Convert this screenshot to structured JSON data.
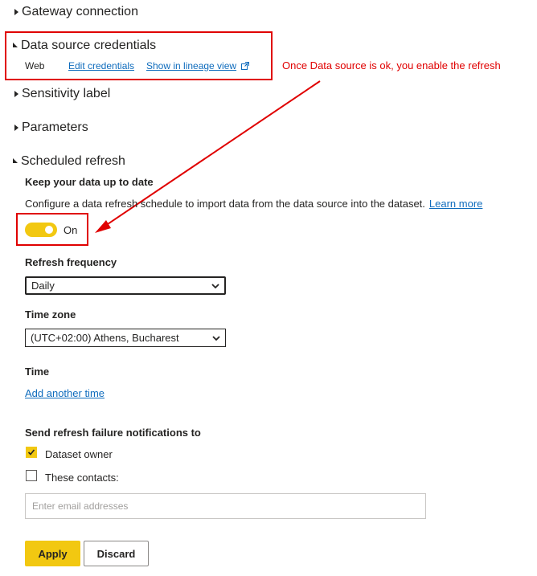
{
  "sections": {
    "gateway": {
      "title": "Gateway connection"
    },
    "credentials": {
      "title": "Data source credentials",
      "source_type": "Web",
      "edit_link": "Edit credentials",
      "lineage_link": "Show in lineage view"
    },
    "sensitivity": {
      "title": "Sensitivity label"
    },
    "parameters": {
      "title": "Parameters"
    },
    "scheduled": {
      "title": "Scheduled refresh",
      "keep_up_to_date": "Keep your data up to date",
      "description": "Configure a data refresh schedule to import data from the data source into the dataset.",
      "learn_more": "Learn more",
      "toggle_label": "On",
      "toggle_on": true,
      "frequency_label": "Refresh frequency",
      "frequency_value": "Daily",
      "timezone_label": "Time zone",
      "timezone_value": "(UTC+02:00) Athens, Bucharest",
      "time_label": "Time",
      "add_time_link": "Add another time",
      "notify_label": "Send refresh failure notifications to",
      "dataset_owner_label": "Dataset owner",
      "dataset_owner_checked": true,
      "contacts_label": "These contacts:",
      "contacts_checked": false,
      "email_placeholder": "Enter email addresses",
      "apply_label": "Apply",
      "discard_label": "Discard"
    }
  },
  "annotation": {
    "text": "Once Data source is ok, you enable the refresh",
    "color": "#e00000"
  },
  "colors": {
    "accent": "#f2c811",
    "link": "#0f6cbd",
    "annotation": "#e00000"
  },
  "icons": {
    "external_link": "external-link-icon",
    "chevron": "chevron-down-icon",
    "check": "checkmark-icon"
  }
}
